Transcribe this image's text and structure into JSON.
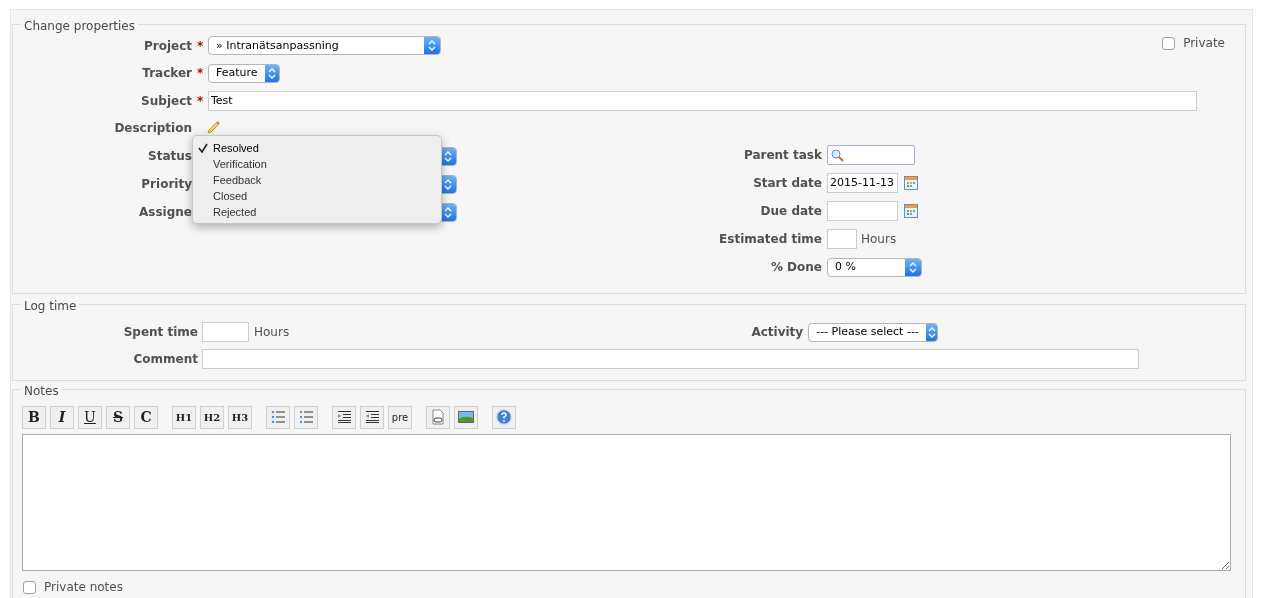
{
  "change_properties": {
    "legend": "Change properties",
    "private": {
      "label": "Private",
      "checked": false
    },
    "left_fields": [
      {
        "kind": "select",
        "label": "Project",
        "mark": "*",
        "value": "» Intranätsanpassning"
      },
      {
        "kind": "select",
        "label": "Tracker",
        "mark": "*",
        "value": "Feature"
      },
      {
        "kind": "text",
        "label": "Subject",
        "mark": "*",
        "value": "Test"
      },
      {
        "kind": "edit",
        "label": "Description"
      }
    ],
    "hidden_selects": [
      {
        "label": "Status"
      },
      {
        "label": "Priority"
      },
      {
        "label": "Assigne"
      }
    ],
    "status_menu": [
      {
        "label": "Resolved",
        "selected": true
      },
      {
        "label": "Verification",
        "selected": false
      },
      {
        "label": "Feedback",
        "selected": false
      },
      {
        "label": "Closed",
        "selected": false
      },
      {
        "label": "Rejected",
        "selected": false
      }
    ],
    "right_fields": [
      {
        "kind": "search",
        "label": "Parent task"
      },
      {
        "kind": "date",
        "label": "Start date",
        "value": "2015-11-13"
      },
      {
        "kind": "date",
        "label": "Due date"
      },
      {
        "kind": "hours",
        "label": "Estimated time",
        "unit": "Hours"
      },
      {
        "kind": "select",
        "label": "% Done",
        "value": "0 %"
      }
    ]
  },
  "log_time": {
    "legend": "Log time",
    "spent_label": "Spent time",
    "unit": "Hours",
    "activity_label": "Activity",
    "activity_value": "--- Please select ---",
    "comment_label": "Comment"
  },
  "notes": {
    "legend": "Notes",
    "toolbar": [
      {
        "kind": "bold",
        "label": "B"
      },
      {
        "kind": "italic",
        "label": "I"
      },
      {
        "kind": "underline",
        "label": "U"
      },
      {
        "kind": "strike",
        "label": "S"
      },
      {
        "kind": "bold",
        "label": "C"
      },
      {
        "kind": "gap"
      },
      {
        "kind": "heading",
        "label": "H1"
      },
      {
        "kind": "heading",
        "label": "H2"
      },
      {
        "kind": "heading",
        "label": "H3"
      },
      {
        "kind": "gap"
      },
      {
        "kind": "bullets"
      },
      {
        "kind": "numbers"
      },
      {
        "kind": "gap"
      },
      {
        "kind": "indent"
      },
      {
        "kind": "outdent"
      },
      {
        "kind": "plain",
        "label": "pre"
      },
      {
        "kind": "gap"
      },
      {
        "kind": "link"
      },
      {
        "kind": "image"
      },
      {
        "kind": "gap"
      },
      {
        "kind": "help"
      }
    ],
    "private_notes": {
      "label": "Private notes",
      "checked": false
    }
  }
}
